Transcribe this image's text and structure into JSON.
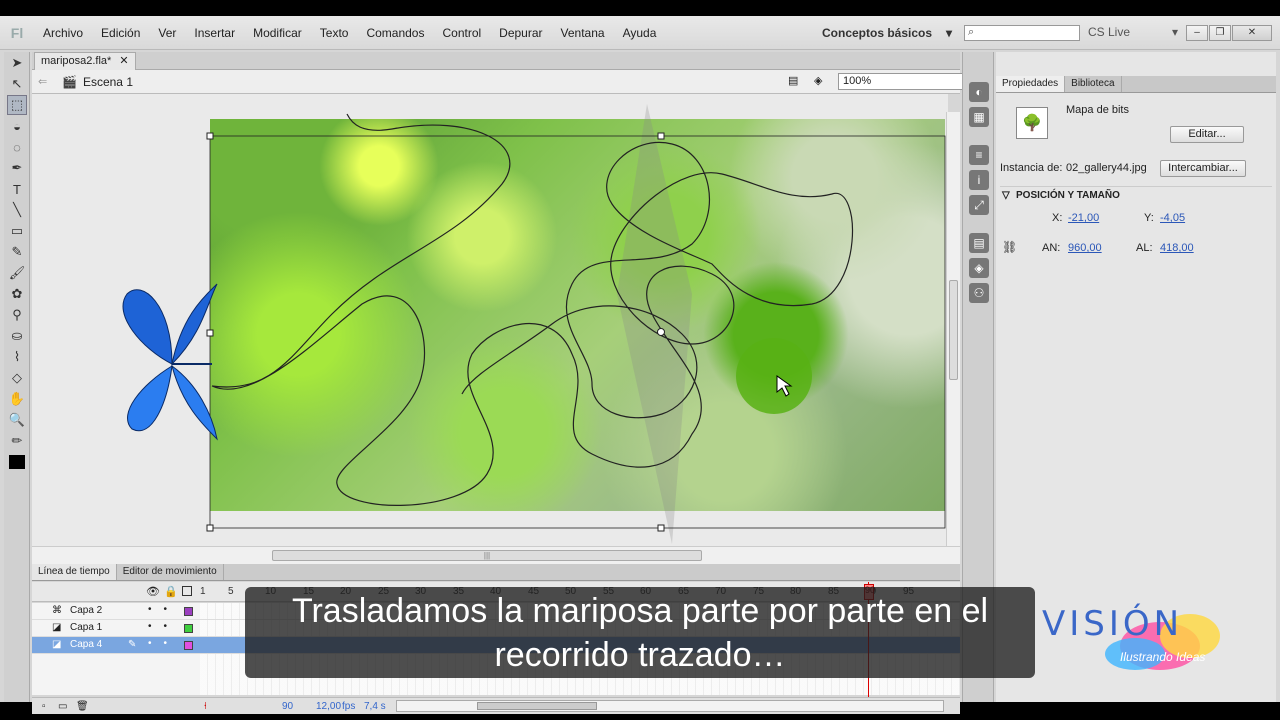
{
  "menu": [
    "Archivo",
    "Edición",
    "Ver",
    "Insertar",
    "Modificar",
    "Texto",
    "Comandos",
    "Control",
    "Depurar",
    "Ventana",
    "Ayuda"
  ],
  "app_logo": "Fl",
  "workspace_label": "Conceptos básicos",
  "cslive_label": "CS Live",
  "search_icon": "⌕",
  "doc_tab": "mariposa2.fla*",
  "scene_label": "Escena 1",
  "zoom": "100%",
  "timeline_tabs": [
    "Línea de tiempo",
    "Editor de movimiento"
  ],
  "ruler_ticks": [
    "1",
    "5",
    "10",
    "15",
    "20",
    "25",
    "30",
    "35",
    "40",
    "45",
    "50",
    "55",
    "60",
    "65",
    "70",
    "75",
    "80",
    "85",
    "90",
    "95"
  ],
  "layers": [
    {
      "name": "Capa 2",
      "color": "#9b3fbf",
      "selected": false
    },
    {
      "name": "Capa 1",
      "color": "#3fcf3f",
      "selected": false
    },
    {
      "name": "Capa 4",
      "color": "#e04fe0",
      "selected": true
    }
  ],
  "footer": {
    "frame": "90",
    "fps": "12,00",
    "fps_unit": "fps",
    "time": "7,4 s"
  },
  "panel": {
    "tabs": [
      "Propiedades",
      "Biblioteca"
    ],
    "type": "Mapa de bits",
    "edit_button": "Editar...",
    "instance_label": "Instancia de:",
    "instance_value": "02_gallery44.jpg",
    "swap_button": "Intercambiar...",
    "section": "POSICIÓN Y TAMAÑO",
    "x_label": "X:",
    "x_value": "-21,00",
    "y_label": "Y:",
    "y_value": "-4,05",
    "w_label": "AN:",
    "w_value": "960,00",
    "h_label": "AL:",
    "h_value": "418,00"
  },
  "caption": {
    "line1": "Trasladamos la mariposa parte por parte en el",
    "line2": "recorrido trazado…"
  },
  "brand": {
    "name": "VISIÓN",
    "tagline": "Ilustrando Ideas"
  },
  "colors": {
    "accent": "#2b57b8",
    "selected_layer": "#7aa6e0",
    "playhead": "#dd0000"
  }
}
